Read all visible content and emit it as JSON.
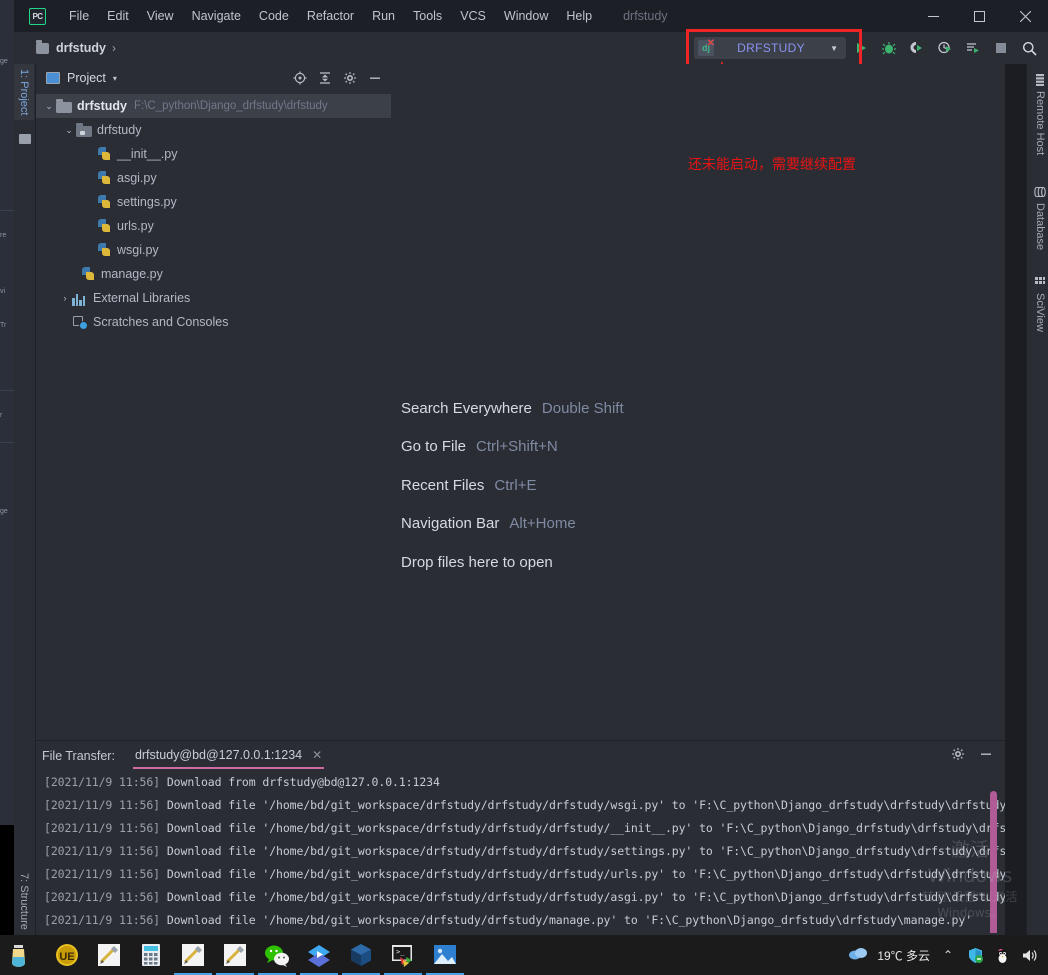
{
  "window": {
    "app_logo": "PC",
    "project_title": "drfstudy",
    "controls": {
      "minimize": "—",
      "maximize": "□",
      "close": "✕"
    }
  },
  "menu": [
    {
      "label": "File"
    },
    {
      "label": "Edit"
    },
    {
      "label": "View"
    },
    {
      "label": "Navigate"
    },
    {
      "label": "Code"
    },
    {
      "label": "Refactor"
    },
    {
      "label": "Run"
    },
    {
      "label": "Tools"
    },
    {
      "label": "VCS"
    },
    {
      "label": "Window"
    },
    {
      "label": "Help"
    }
  ],
  "navbar": {
    "breadcrumb": "drfstudy",
    "separator": "›",
    "run_config": {
      "label": "DRFSTUDY",
      "icon": "django-icon",
      "error_badge": "✕",
      "dropdown": "▼"
    },
    "actions": [
      {
        "name": "run-button",
        "glyph": "▶"
      },
      {
        "name": "debug-button",
        "glyph": "🐞"
      },
      {
        "name": "run-coverage-button",
        "glyph": "◐"
      },
      {
        "name": "profile-button",
        "glyph": "◔"
      },
      {
        "name": "run-with-console-button",
        "glyph": "≡"
      },
      {
        "name": "stop-button",
        "glyph": "■"
      },
      {
        "name": "search-button",
        "glyph": "🔍"
      }
    ]
  },
  "left_strip": {
    "tabs": [
      {
        "label": "1: Project",
        "active": true
      }
    ],
    "bottom_tabs": [
      {
        "label": "7: Structure"
      }
    ]
  },
  "right_strip": {
    "tabs": [
      {
        "label": "Remote Host",
        "icon": "remote-host-icon"
      },
      {
        "label": "Database",
        "icon": "database-icon"
      },
      {
        "label": "SciView",
        "icon": "sciview-icon"
      }
    ]
  },
  "project_panel": {
    "title": "Project",
    "caret": "▾",
    "actions": [
      {
        "name": "locate-icon",
        "glyph": "⊕"
      },
      {
        "name": "collapse-all-icon",
        "glyph": "⤒"
      },
      {
        "name": "settings-gear-icon",
        "glyph": "⚙"
      },
      {
        "name": "hide-panel-icon",
        "glyph": "—"
      }
    ],
    "tree": [
      {
        "label": "drfstudy",
        "path": "F:\\C_python\\Django_drfstudy\\drfstudy",
        "icon": "folder-icon",
        "twisty": "⌄",
        "indent": 0,
        "selected": true
      },
      {
        "label": "drfstudy",
        "path": "",
        "icon": "module-icon",
        "twisty": "⌄",
        "indent": 1,
        "selected": false
      },
      {
        "label": "__init__.py",
        "path": "",
        "icon": "python-file-icon",
        "twisty": "",
        "indent": 2,
        "selected": false
      },
      {
        "label": "asgi.py",
        "path": "",
        "icon": "python-file-icon",
        "twisty": "",
        "indent": 2,
        "selected": false
      },
      {
        "label": "settings.py",
        "path": "",
        "icon": "python-file-icon",
        "twisty": "",
        "indent": 2,
        "selected": false
      },
      {
        "label": "urls.py",
        "path": "",
        "icon": "python-file-icon",
        "twisty": "",
        "indent": 2,
        "selected": false
      },
      {
        "label": "wsgi.py",
        "path": "",
        "icon": "python-file-icon",
        "twisty": "",
        "indent": 2,
        "selected": false
      },
      {
        "label": "manage.py",
        "path": "",
        "icon": "python-file-icon",
        "twisty": "",
        "indent": 1,
        "selected": false
      },
      {
        "label": "External Libraries",
        "path": "",
        "icon": "library-icon",
        "twisty": "›",
        "indent": 0,
        "selected": false
      },
      {
        "label": "Scratches and Consoles",
        "path": "",
        "icon": "scratches-icon",
        "twisty": "",
        "indent": 0,
        "selected": false
      }
    ]
  },
  "editor": {
    "hints": [
      {
        "action": "Search Everywhere",
        "key": "Double Shift"
      },
      {
        "action": "Go to File",
        "key": "Ctrl+Shift+N"
      },
      {
        "action": "Recent Files",
        "key": "Ctrl+E"
      },
      {
        "action": "Navigation Bar",
        "key": "Alt+Home"
      },
      {
        "action": "Drop files here to open",
        "key": ""
      }
    ],
    "annotation": "还未能启动，需要继续配置",
    "annotation_color": "#e81313"
  },
  "file_transfer": {
    "label": "File Transfer:",
    "tab": "drfstudy@bd@127.0.0.1:1234",
    "tab_close": "✕",
    "actions": [
      {
        "name": "settings-gear-icon",
        "glyph": "⚙"
      },
      {
        "name": "hide-panel-icon",
        "glyph": "—"
      }
    ],
    "log": [
      {
        "ts": "[2021/11/9 11:56]",
        "text": "Download from drfstudy@bd@127.0.0.1:1234"
      },
      {
        "ts": "[2021/11/9 11:56]",
        "text": "Download file '/home/bd/git_workspace/drfstudy/drfstudy/drfstudy/wsgi.py' to 'F:\\C_python\\Django_drfstudy\\drfstudy\\drfstudy\\wsgi.py'"
      },
      {
        "ts": "[2021/11/9 11:56]",
        "text": "Download file '/home/bd/git_workspace/drfstudy/drfstudy/drfstudy/__init__.py' to 'F:\\C_python\\Django_drfstudy\\drfstudy\\drfstudy\\__init__.py'"
      },
      {
        "ts": "[2021/11/9 11:56]",
        "text": "Download file '/home/bd/git_workspace/drfstudy/drfstudy/drfstudy/settings.py' to 'F:\\C_python\\Django_drfstudy\\drfstudy\\drfstudy\\settings.py'"
      },
      {
        "ts": "[2021/11/9 11:56]",
        "text": "Download file '/home/bd/git_workspace/drfstudy/drfstudy/drfstudy/urls.py' to 'F:\\C_python\\Django_drfstudy\\drfstudy\\drfstudy\\urls.py'"
      },
      {
        "ts": "[2021/11/9 11:56]",
        "text": "Download file '/home/bd/git_workspace/drfstudy/drfstudy/drfstudy/asgi.py' to 'F:\\C_python\\Django_drfstudy\\drfstudy\\drfstudy\\asgi.py'"
      },
      {
        "ts": "[2021/11/9 11:56]",
        "text": "Download file '/home/bd/git_workspace/drfstudy/drfstudy/manage.py' to 'F:\\C_python\\Django_drfstudy\\drfstudy\\manage.py'"
      }
    ]
  },
  "watermark": {
    "line1": "激活 Windows",
    "line2": "转到\"设置\"以激活 Windows。"
  },
  "taskbar": {
    "start": "start-icon",
    "apps": [
      {
        "name": "taskbar-ultraedit",
        "running": false
      },
      {
        "name": "taskbar-tool-1",
        "running": false
      },
      {
        "name": "taskbar-calculator",
        "running": false
      },
      {
        "name": "taskbar-tool-2",
        "running": true
      },
      {
        "name": "taskbar-tool-3",
        "running": true
      },
      {
        "name": "taskbar-wechat",
        "running": true
      },
      {
        "name": "taskbar-editor",
        "running": true
      },
      {
        "name": "taskbar-virtualbox",
        "running": true
      },
      {
        "name": "taskbar-terminal",
        "running": true
      },
      {
        "name": "taskbar-photos",
        "running": true
      }
    ],
    "tray": {
      "weather": "19℃ 多云",
      "chevron": "⌃",
      "icons": [
        {
          "name": "security-shield-icon"
        },
        {
          "name": "qq-penguin-icon"
        },
        {
          "name": "volume-icon"
        }
      ]
    }
  }
}
